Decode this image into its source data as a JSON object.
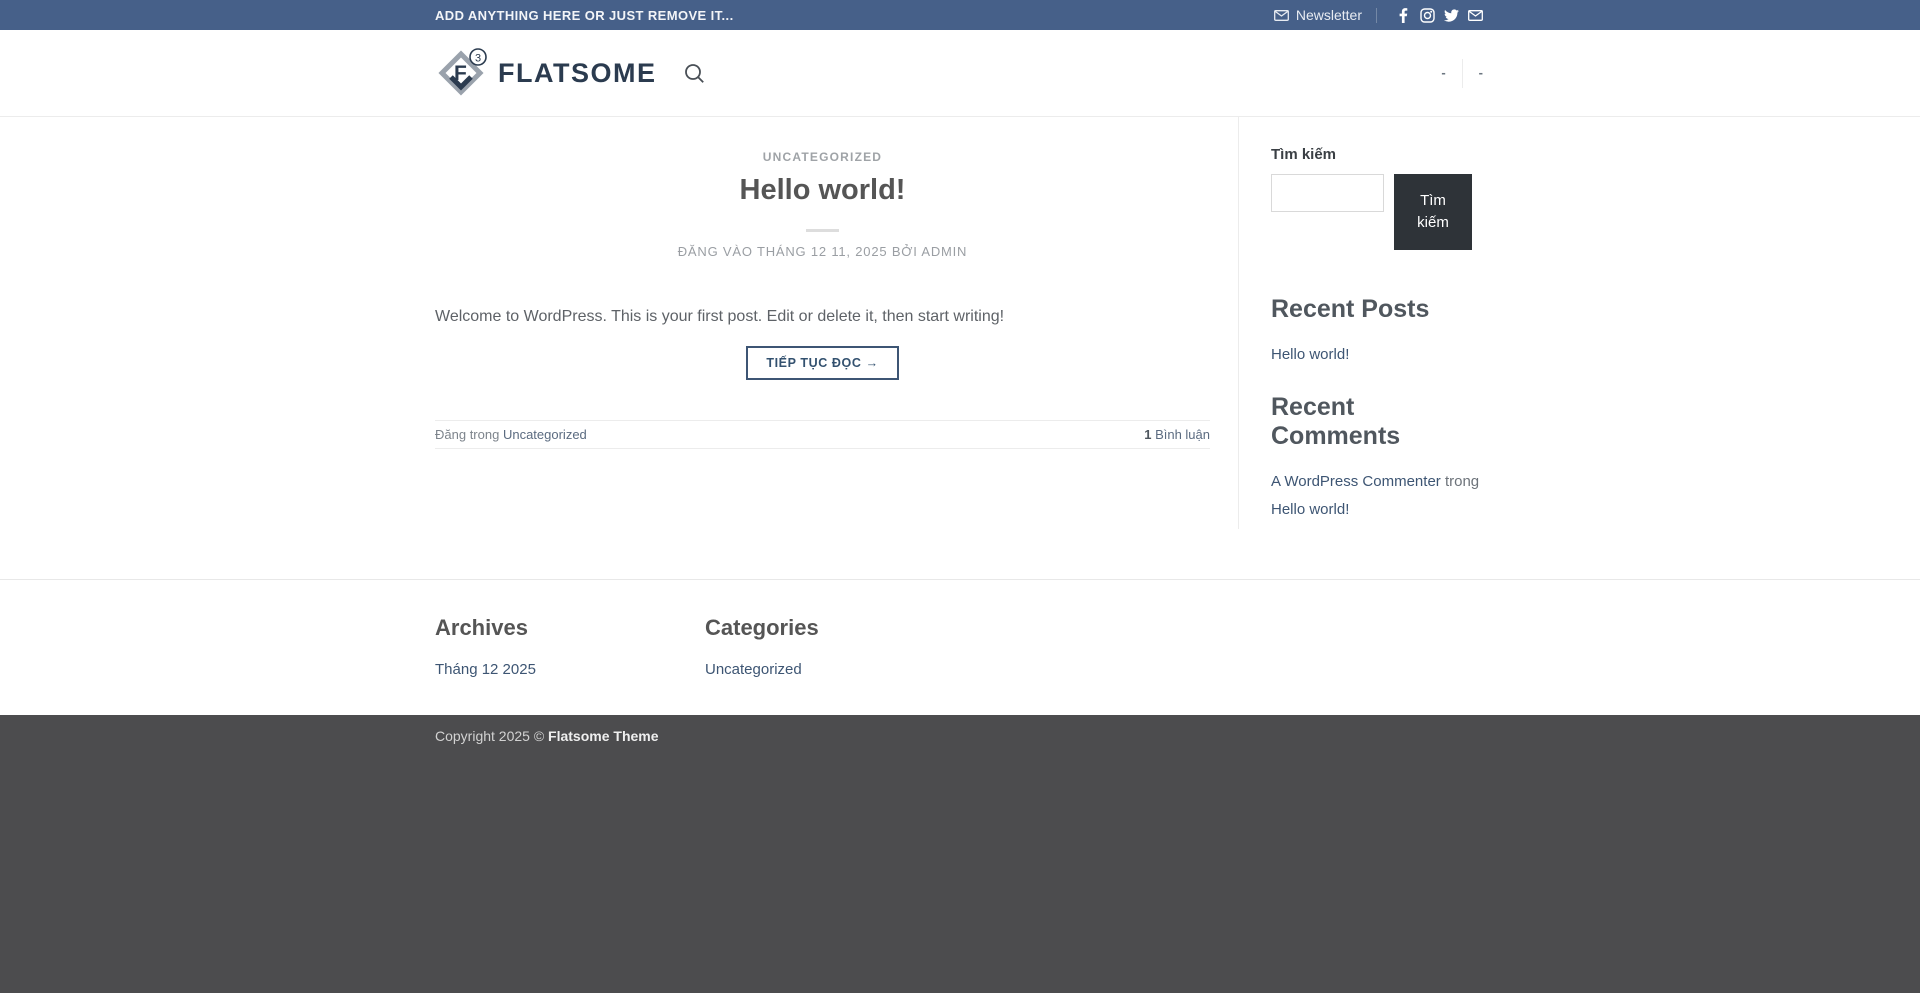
{
  "topbar": {
    "message": "ADD ANYTHING HERE OR JUST REMOVE IT...",
    "newsletter": {
      "label": "Newsletter",
      "icon": "envelope-icon"
    },
    "social_icons": [
      "facebook-icon",
      "instagram-icon",
      "twitter-icon",
      "email-icon"
    ]
  },
  "header": {
    "logo": {
      "text": "FLATSOME",
      "badge": "3"
    },
    "search_icon": "magnifier-icon",
    "menu": [
      {
        "label": "-"
      },
      {
        "label": "-"
      }
    ]
  },
  "post": {
    "category": "UNCATEGORIZED",
    "title": "Hello world!",
    "meta": {
      "prefix": "ĐĂNG VÀO",
      "date": "THÁNG 12 11, 2025",
      "by": "BỞI",
      "author": "ADMIN"
    },
    "body": "Welcome to WordPress. This is your first post. Edit or delete it, then start writing!",
    "read_more": "TIẾP TỤC ĐỌC →",
    "footer": {
      "posted_in": "Đăng trong",
      "category": "Uncategorized",
      "comments_count": "1",
      "comments_label": "Bình luận"
    }
  },
  "sidebar": {
    "search": {
      "title": "Tìm kiếm",
      "input_value": "",
      "button": "Tìm kiếm"
    },
    "recent_posts": {
      "title": "Recent Posts",
      "items": [
        {
          "label": "Hello world!"
        }
      ]
    },
    "recent_comments": {
      "title": "Recent Comments",
      "items": [
        {
          "author": "A WordPress Commenter",
          "connector": "trong",
          "post": "Hello world!"
        }
      ]
    }
  },
  "footer": {
    "archives": {
      "title": "Archives",
      "items": [
        {
          "label": "Tháng 12 2025"
        }
      ]
    },
    "categories": {
      "title": "Categories",
      "items": [
        {
          "label": "Uncategorized"
        }
      ]
    }
  },
  "copyright": {
    "prefix": "Copyright 2025 ©",
    "brand": "Flatsome Theme"
  },
  "colors": {
    "topbar_bg": "#466089",
    "brand_navy": "#2b3b4f",
    "link": "#3d5573",
    "button_outline": "#3d5574",
    "search_button_bg": "#2e3338",
    "footer_bg": "#4c4c4e"
  }
}
